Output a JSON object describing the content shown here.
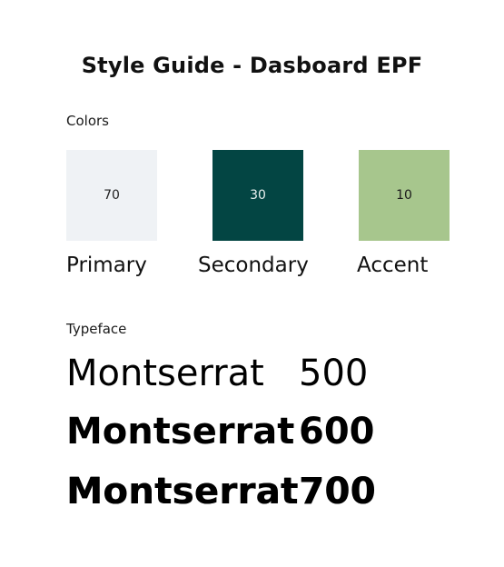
{
  "title": "Style Guide - Dasboard EPF",
  "colors": {
    "label": "Colors",
    "swatches": [
      {
        "name": "Primary",
        "value": "70",
        "color": "#eff2f5",
        "text_color": "#222222"
      },
      {
        "name": "Secondary",
        "value": "30",
        "color": "#034543",
        "text_color": "#e8f0ef"
      },
      {
        "name": "Accent",
        "value": "10",
        "color": "#a7c68d",
        "text_color": "#1a1a1a"
      }
    ]
  },
  "typeface": {
    "label": "Typeface",
    "samples": [
      {
        "name": "Montserrat",
        "weight": "500"
      },
      {
        "name": "Montserrat",
        "weight": "600"
      },
      {
        "name": "Montserrat",
        "weight": "700"
      }
    ]
  }
}
